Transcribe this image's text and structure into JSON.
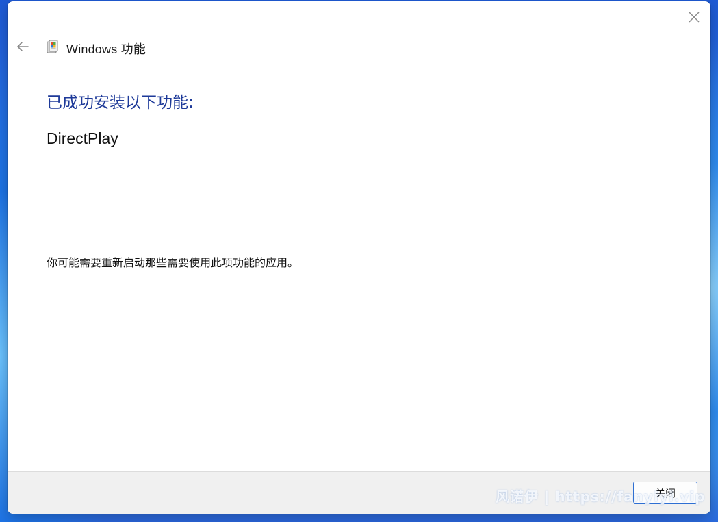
{
  "window": {
    "title": "Windows 功能",
    "close_icon": "close-icon",
    "back_icon": "back-arrow-icon",
    "app_icon": "windows-features-icon"
  },
  "content": {
    "heading": "已成功安装以下功能:",
    "feature": "DirectPlay",
    "note": "你可能需要重新启动那些需要使用此项功能的应用。"
  },
  "footer": {
    "close_label": "关闭"
  },
  "watermark": {
    "text": "风诺伊 | https://fanyiyi.vip"
  },
  "colors": {
    "heading": "#1e3a99",
    "button_border": "#2e6fd3",
    "footer_bg": "#f0f0f0"
  }
}
